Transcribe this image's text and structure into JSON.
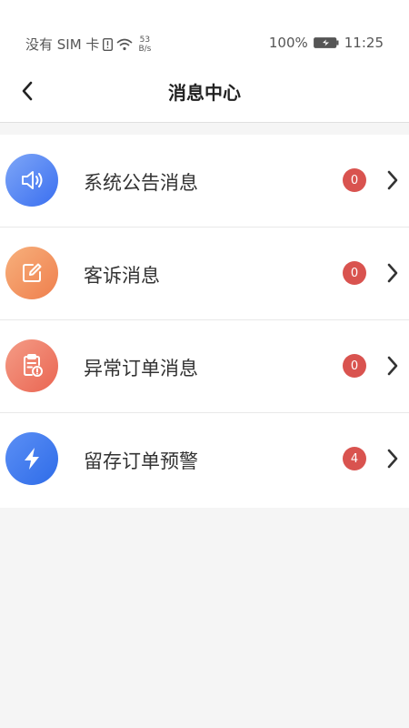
{
  "status_bar": {
    "carrier": "没有 SIM 卡",
    "net_speed_value": "53",
    "net_speed_unit": "B/s",
    "battery": "100%",
    "time": "11:25"
  },
  "header": {
    "title": "消息中心"
  },
  "items": [
    {
      "label": "系统公告消息",
      "badge": "0",
      "icon": "speaker-icon",
      "color_from": "#7ea6f7",
      "color_to": "#3a6ff0"
    },
    {
      "label": "客诉消息",
      "badge": "0",
      "icon": "edit-icon",
      "color_from": "#f7b07c",
      "color_to": "#ef7f4d"
    },
    {
      "label": "异常订单消息",
      "badge": "0",
      "icon": "clipboard-alert-icon",
      "color_from": "#f49c86",
      "color_to": "#ea6552"
    },
    {
      "label": "留存订单预警",
      "badge": "4",
      "icon": "lightning-icon",
      "color_from": "#5b8ff5",
      "color_to": "#2f6ce8"
    }
  ],
  "colors": {
    "badge": "#d9534f",
    "background": "#f5f5f5"
  }
}
